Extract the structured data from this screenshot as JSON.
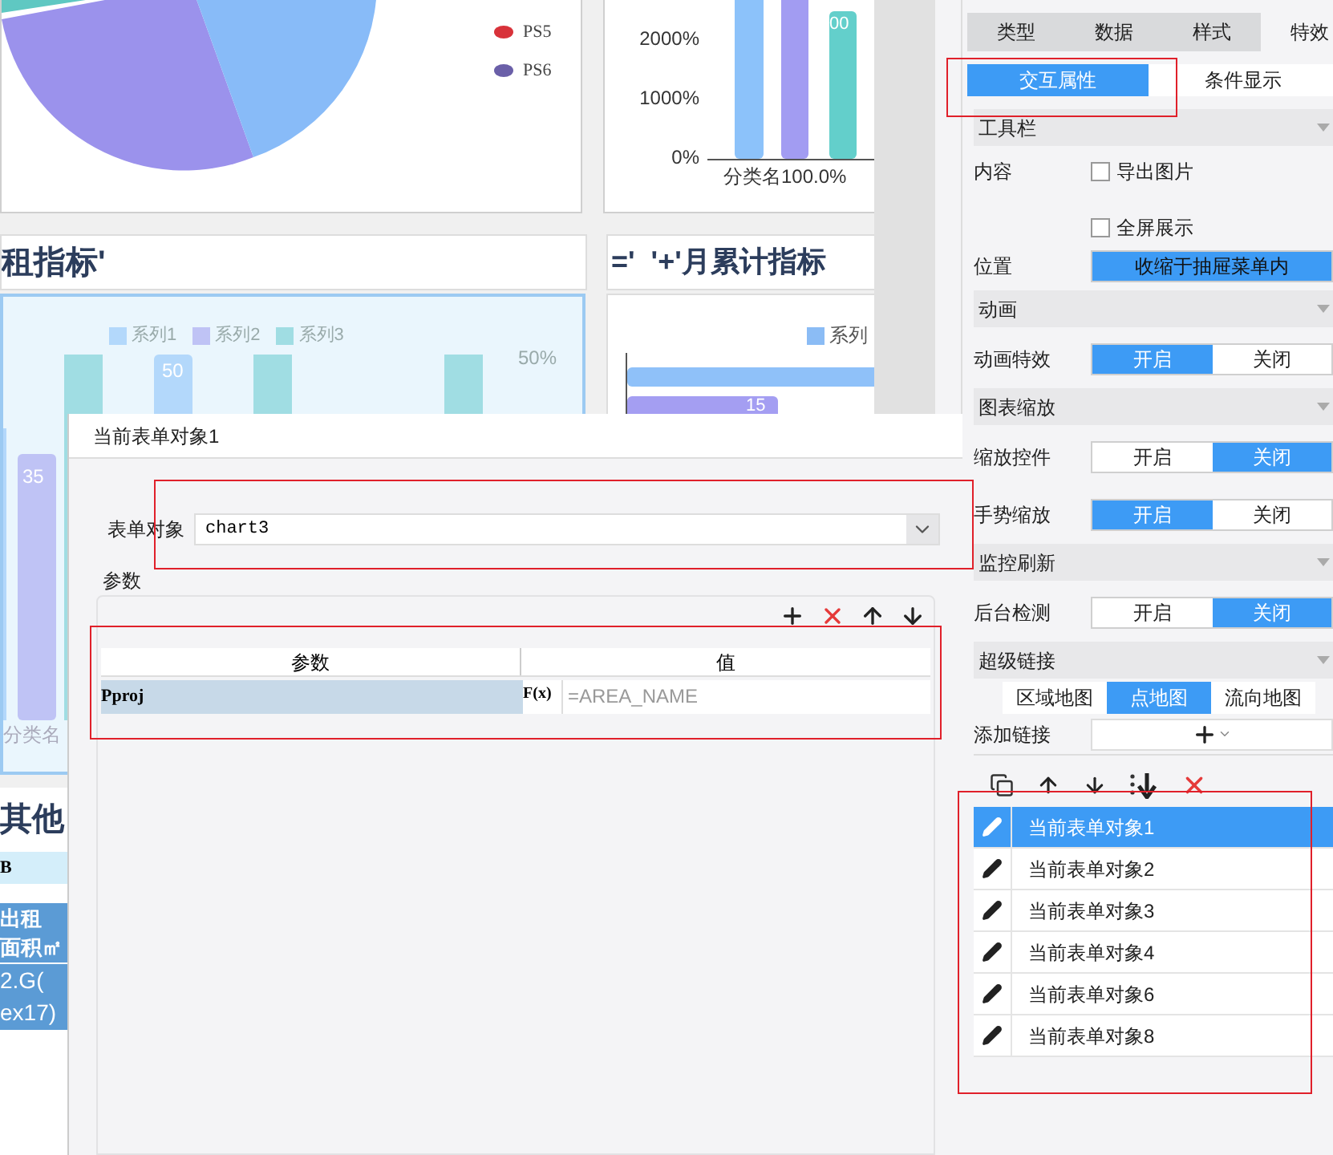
{
  "dashboard": {
    "pie_legend": [
      {
        "label": "PS5",
        "color": "#d8323a"
      },
      {
        "label": "PS6",
        "color": "#6a5fa8"
      }
    ],
    "bar_ticks": [
      "2000%",
      "1000%",
      "0%"
    ],
    "bar_value": "00",
    "bar_category": "分类名100.0%",
    "left_title": "租指标'",
    "right_title": "='  '+'月累计指标",
    "legend": [
      {
        "label": "系列1",
        "color": "#b3d8fb"
      },
      {
        "label": "系列2",
        "color": "#bfc3f5"
      },
      {
        "label": "系列3",
        "color": "#a0dde3"
      }
    ],
    "bar_labels": [
      "50",
      "35"
    ],
    "percent_label": "50%",
    "category_label": "分类名",
    "right_legend": {
      "label": "系列",
      "color": "#8bbcf5"
    },
    "right_bar_label": "15",
    "table_title": "其他",
    "table_header": "B",
    "table_cells": [
      [
        "出租",
        "面积㎡"
      ],
      [
        "2.G(",
        "ex17)"
      ]
    ]
  },
  "dialog": {
    "title": "当前表单对象1",
    "object_label": "表单对象",
    "object_value": "chart3",
    "params_label": "参数",
    "columns": [
      "参数",
      "值"
    ],
    "formula_label": "F(x)",
    "rows": [
      {
        "name": "Pproj",
        "value": "=AREA_NAME"
      }
    ]
  },
  "panel": {
    "tabs": [
      {
        "label": "类型",
        "selected": false
      },
      {
        "label": "数据",
        "selected": false
      },
      {
        "label": "样式",
        "selected": false
      },
      {
        "label": "特效",
        "selected": true
      }
    ],
    "subtabs": [
      {
        "label": "交互属性",
        "selected": true
      },
      {
        "label": "条件显示",
        "selected": false
      }
    ],
    "sections": [
      {
        "title": "工具栏",
        "rows": [
          {
            "kind": "checkboxes",
            "label": "内容",
            "options": [
              {
                "label": "导出图片",
                "checked": false
              },
              {
                "label": "全屏展示",
                "checked": false
              }
            ]
          },
          {
            "kind": "select",
            "label": "位置",
            "value": "收缩于抽屉菜单内"
          }
        ]
      },
      {
        "title": "动画",
        "rows": [
          {
            "kind": "toggle",
            "label": "动画特效",
            "options": [
              {
                "label": "开启",
                "selected": true
              },
              {
                "label": "关闭",
                "selected": false
              }
            ]
          }
        ]
      },
      {
        "title": "图表缩放",
        "rows": [
          {
            "kind": "toggle",
            "label": "缩放控件",
            "options": [
              {
                "label": "开启",
                "selected": false
              },
              {
                "label": "关闭",
                "selected": true
              }
            ]
          },
          {
            "kind": "toggle",
            "label": "手势缩放",
            "options": [
              {
                "label": "开启",
                "selected": true
              },
              {
                "label": "关闭",
                "selected": false
              }
            ]
          }
        ]
      },
      {
        "title": "监控刷新",
        "rows": [
          {
            "kind": "toggle",
            "label": "后台检测",
            "options": [
              {
                "label": "开启",
                "selected": false
              },
              {
                "label": "关闭",
                "selected": true
              }
            ]
          }
        ]
      },
      {
        "title": "超级链接",
        "rows": [
          {
            "kind": "tabs",
            "options": [
              {
                "label": "区域地图",
                "selected": false
              },
              {
                "label": "点地图",
                "selected": true
              },
              {
                "label": "流向地图",
                "selected": false
              }
            ]
          },
          {
            "kind": "add",
            "label": "添加链接"
          }
        ]
      }
    ],
    "links": [
      {
        "label": "当前表单对象1",
        "selected": true
      },
      {
        "label": "当前表单对象2",
        "selected": false
      },
      {
        "label": "当前表单对象3",
        "selected": false
      },
      {
        "label": "当前表单对象4",
        "selected": false
      },
      {
        "label": "当前表单对象6",
        "selected": false
      },
      {
        "label": "当前表单对象8",
        "selected": false
      }
    ]
  }
}
